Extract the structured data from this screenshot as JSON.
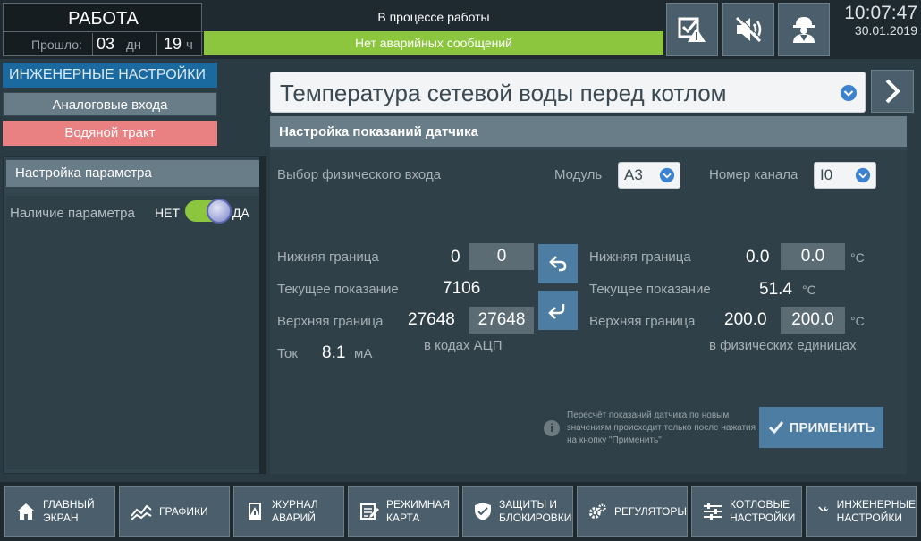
{
  "top": {
    "mode": "РАБОТА",
    "elapsed_label": "Прошло:",
    "days": "03",
    "days_unit": "дн",
    "hours": "19",
    "hours_unit": "ч",
    "status": "В процессе работы",
    "alarm_status": "Нет аварийных сообщений",
    "time": "10:07:47",
    "date": "30.01.2019"
  },
  "left": {
    "section_title": "ИНЖЕНЕРНЫЕ НАСТРОЙКИ",
    "nav_analog": "Аналоговые входа",
    "nav_water": "Водяной тракт",
    "param_head": "Настройка параметра",
    "param_label": "Наличие параметра",
    "toggle_off": "НЕТ",
    "toggle_on": "ДА",
    "toggle_state": true
  },
  "sensor": {
    "name": "Температура сетевой воды перед котлом"
  },
  "card": {
    "title": "Настройка показаний датчика",
    "phys_input_label": "Выбор физического входа",
    "module_label": "Модуль",
    "module_value": "A3",
    "channel_label": "Номер канала",
    "channel_value": "I0",
    "adc": {
      "lower_label": "Нижняя граница",
      "lower_value": "0",
      "lower_input": "0",
      "current_label": "Текущее показание",
      "current_value": "7106",
      "upper_label": "Верхняя граница",
      "upper_value": "27648",
      "upper_input": "27648",
      "caption": "в кодах АЦП",
      "current_ma_label": "Ток",
      "current_ma_value": "8.1",
      "current_ma_unit": "мА"
    },
    "phys": {
      "lower_label": "Нижняя граница",
      "lower_value": "0.0",
      "lower_input": "0.0",
      "lower_unit": "°C",
      "current_label": "Текущее показание",
      "current_value": "51.4",
      "current_unit": "°C",
      "upper_label": "Верхняя граница",
      "upper_value": "200.0",
      "upper_input": "200.0",
      "upper_unit": "°C",
      "caption": "в физических единицах"
    },
    "info": "Пересчёт показаний датчика по новым значениям происходит только после нажатия на кнопку \"Применить\"",
    "apply": "ПРИМЕНИТЬ"
  },
  "bottom_nav": [
    {
      "label": "ГЛАВНЫЙ\nЭКРАН",
      "icon": "home-icon"
    },
    {
      "label": "ГРАФИКИ",
      "icon": "chart-icon"
    },
    {
      "label": "ЖУРНАЛ\nАВАРИЙ",
      "icon": "alarm-log-icon"
    },
    {
      "label": "РЕЖИМНАЯ\nКАРТА",
      "icon": "mode-map-icon"
    },
    {
      "label": "ЗАЩИТЫ И\nБЛОКИРОВКИ",
      "icon": "shield-icon"
    },
    {
      "label": "РЕГУЛЯТОРЫ",
      "icon": "gears-icon"
    },
    {
      "label": "КОТЛОВЫЕ\nНАСТРОЙКИ",
      "icon": "sliders-icon"
    },
    {
      "label": "ИНЖЕНЕРНЫЕ\nНАСТРОЙКИ",
      "icon": "wrench-icon"
    }
  ],
  "colors": {
    "background": "#2b3b43",
    "accent_blue": "#1a6aa0",
    "ok_green": "#8cc63f",
    "water_nav": "#e98081",
    "button": "#4a5f6b",
    "apply": "#4e7da3"
  }
}
